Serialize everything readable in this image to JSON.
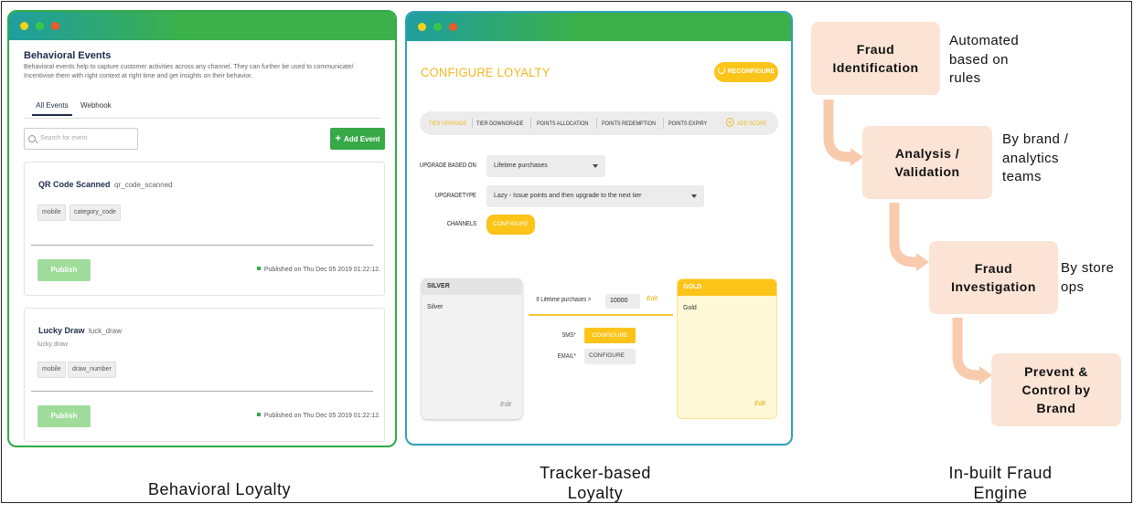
{
  "behavioral_window": {
    "title": "Behavioral Events",
    "description": "Behavioral events help to capture customer activities across any channel. They can further be used to communicate/ Incentivise them with right context at right time and get insights on their behavior.",
    "tabs": [
      "All Events",
      "Webhook"
    ],
    "search_placeholder": "Search for event",
    "add_button": "Add Event",
    "events": [
      {
        "name": "QR Code Scanned",
        "key": "qr_code_scanned",
        "subtitle": "",
        "tags": [
          "mobile",
          "category_code"
        ],
        "publish_label": "Publish",
        "status": "Published on Thu Dec 05 2019 01:22:12."
      },
      {
        "name": "Lucky Draw",
        "key": "luck_draw",
        "subtitle": "lucky draw",
        "tags": [
          "mobile",
          "draw_number"
        ],
        "publish_label": "Publish",
        "status": "Published on Thu Dec 05 2019 01:22:12."
      }
    ]
  },
  "loyalty_window": {
    "title": "CONFIGURE LOYALTY",
    "reconfigure": "RECONFIGURE",
    "tabs": [
      "TIER UPGRADE",
      "TIER DOWNGRADE",
      "POINTS ALLOCATION",
      "POINTS REDEMPTION",
      "POINTS EXPIRY"
    ],
    "add_scope": "ADD SCOPE",
    "fields": {
      "upgrade_based_on_label": "UPGRADE BASED ON",
      "upgrade_based_on_value": "Lifetime purchases",
      "upgrade_type_label": "UPGRADETYPE",
      "upgrade_type_value": "Lazy - Issue points and then upgrade to the next tier",
      "channels_label": "CHANNELS",
      "channels_button": "CONFIGURE"
    },
    "silver": {
      "header": "SILVER",
      "name": "Silver",
      "edit": "Edit"
    },
    "gold": {
      "header": "GOLD",
      "name": "Gold",
      "edit": "Edit"
    },
    "condition_label": "If Lifetime purchases >",
    "condition_value": "10000",
    "condition_edit": "Edit",
    "sms_label": "SMS*",
    "sms_button": "CONFIGURE",
    "email_label": "EMAIL*",
    "email_button": "CONFIGURE"
  },
  "fraud_engine": {
    "steps": [
      {
        "label": "Fraud\nIdentification",
        "desc": "Automated\nbased on\nrules"
      },
      {
        "label": "Analysis /\nValidation",
        "desc": "By brand /\nanalytics\nteams"
      },
      {
        "label": "Fraud\nInvestigation",
        "desc": "By store\nops"
      },
      {
        "label": "Prevent &\nControl by\nBrand",
        "desc": ""
      }
    ],
    "arrow_color": "#f8cbad"
  },
  "captions": {
    "left": "Behavioral Loyalty",
    "middle": "Tracker-based\nLoyalty",
    "right": "In-built Fraud\nEngine"
  }
}
